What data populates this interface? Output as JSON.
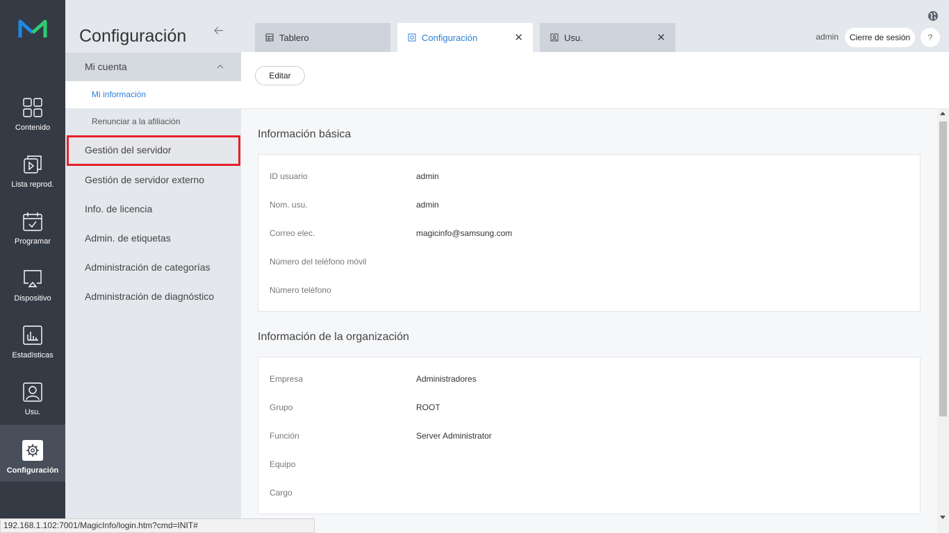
{
  "rail": {
    "items": [
      {
        "label": "Contenido",
        "icon": "grid-icon"
      },
      {
        "label": "Lista reprod.",
        "icon": "playlist-icon"
      },
      {
        "label": "Programar",
        "icon": "calendar-icon"
      },
      {
        "label": "Dispositivo",
        "icon": "monitor-icon"
      },
      {
        "label": "Estadísticas",
        "icon": "bar-chart-icon"
      },
      {
        "label": "Usu.",
        "icon": "user-icon"
      },
      {
        "label": "Configuración",
        "icon": "gear-icon",
        "active": true
      }
    ],
    "colors": {
      "bg": "#353b45",
      "active_bg": "#484f5b",
      "logo_left": "#1e88e5",
      "logo_right": "#2ecc71"
    }
  },
  "menu": {
    "title": "Configuración",
    "group": {
      "label": "Mi cuenta",
      "expanded": true
    },
    "sub_items": [
      {
        "label": "Mi información",
        "active": true
      },
      {
        "label": "Renunciar a la afiliación"
      }
    ],
    "items": [
      {
        "label": "Gestión del servidor",
        "highlighted": true
      },
      {
        "label": "Gestión de servidor externo"
      },
      {
        "label": "Info. de licencia"
      },
      {
        "label": "Admin. de etiquetas"
      },
      {
        "label": "Administración de categorías"
      },
      {
        "label": "Administración de diagnóstico"
      }
    ],
    "highlight_color": "#e5202a"
  },
  "tabs": [
    {
      "label": "Tablero",
      "icon": "dashboard-icon",
      "closable": false
    },
    {
      "label": "Configuración",
      "icon": "settings-icon",
      "closable": true,
      "active": true
    },
    {
      "label": "Usu.",
      "icon": "user-icon",
      "closable": true
    }
  ],
  "header": {
    "user": "admin",
    "logout": "Cierre de sesión",
    "help": "?"
  },
  "toolbar": {
    "edit": "Editar"
  },
  "content": {
    "basic": {
      "title": "Información básica",
      "rows": [
        {
          "key": "ID usuario",
          "value": "admin"
        },
        {
          "key": "Nom. usu.",
          "value": "admin"
        },
        {
          "key": "Correo elec.",
          "value": "magicinfo@samsung.com"
        },
        {
          "key": "Número del teléfono móvil",
          "value": ""
        },
        {
          "key": "Número teléfono",
          "value": ""
        }
      ]
    },
    "org": {
      "title": "Información de la organización",
      "rows": [
        {
          "key": "Empresa",
          "value": "Administradores"
        },
        {
          "key": "Grupo",
          "value": "ROOT"
        },
        {
          "key": "Función",
          "value": "Server Administrator"
        },
        {
          "key": "Equipo",
          "value": ""
        },
        {
          "key": "Cargo",
          "value": ""
        }
      ]
    }
  },
  "status_url": "192.168.1.102:7001/MagicInfo/login.htm?cmd=INIT#",
  "accent_color": "#2d7fd9"
}
